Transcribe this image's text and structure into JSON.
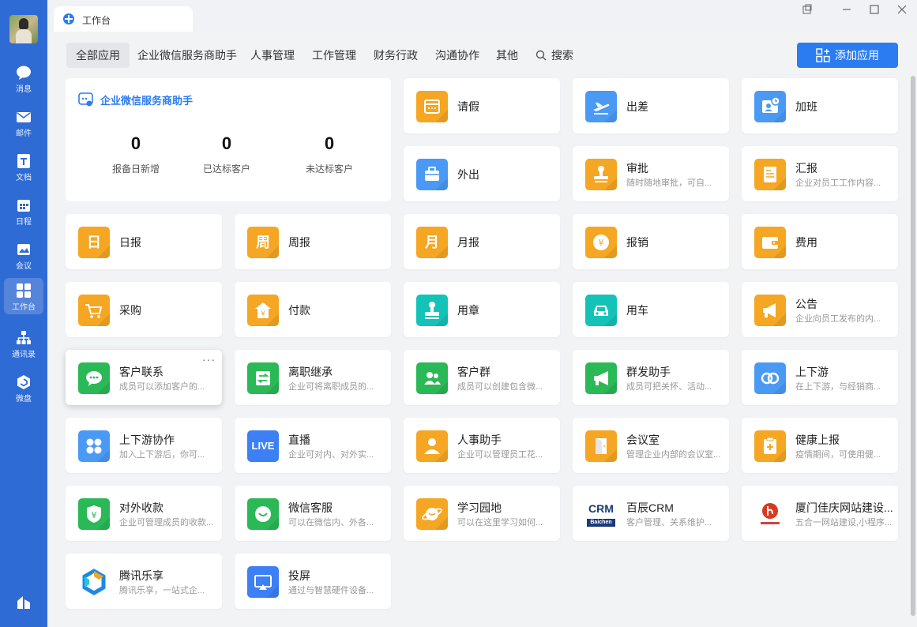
{
  "sidebar": {
    "items": [
      {
        "label": "消息",
        "icon": "chat-icon"
      },
      {
        "label": "邮件",
        "icon": "mail-icon"
      },
      {
        "label": "文档",
        "icon": "doc-icon"
      },
      {
        "label": "日程",
        "icon": "calendar-icon"
      },
      {
        "label": "会议",
        "icon": "meeting-icon"
      },
      {
        "label": "工作台",
        "icon": "grid-icon",
        "active": true
      },
      {
        "label": "通讯录",
        "icon": "contacts-icon"
      },
      {
        "label": "微盘",
        "icon": "drive-icon"
      }
    ]
  },
  "tab": {
    "title": "工作台"
  },
  "categories": [
    "全部应用",
    "企业微信服务商助手",
    "人事管理",
    "工作管理",
    "财务行政",
    "沟通协作",
    "其他",
    "搜索"
  ],
  "add_button": "添加应用",
  "helper": {
    "title": "企业微信服务商助手",
    "stats": [
      {
        "value": "0",
        "label": "报备日新增"
      },
      {
        "value": "0",
        "label": "已达标客户"
      },
      {
        "value": "0",
        "label": "未达标客户"
      }
    ]
  },
  "apps": [
    {
      "name": "请假",
      "desc": "",
      "color": "#f5a623",
      "icon": "calendar-leave-icon"
    },
    {
      "name": "出差",
      "desc": "",
      "color": "#4a9af5",
      "icon": "airplane-icon"
    },
    {
      "name": "加班",
      "desc": "",
      "color": "#4a9af5",
      "icon": "overtime-icon"
    },
    {
      "name": "外出",
      "desc": "",
      "color": "#4a9af5",
      "icon": "briefcase-icon"
    },
    {
      "name": "审批",
      "desc": "随时随地审批，可自...",
      "color": "#f5a623",
      "icon": "stamp-icon"
    },
    {
      "name": "汇报",
      "desc": "企业对员工工作内容...",
      "color": "#f5a623",
      "icon": "report-doc-icon"
    },
    {
      "name": "日报",
      "desc": "",
      "color": "#f5a623",
      "icon": "daily-icon",
      "glyph": "日"
    },
    {
      "name": "周报",
      "desc": "",
      "color": "#f5a623",
      "icon": "weekly-icon",
      "glyph": "周"
    },
    {
      "name": "月报",
      "desc": "",
      "color": "#f5a623",
      "icon": "monthly-icon",
      "glyph": "月"
    },
    {
      "name": "报销",
      "desc": "",
      "color": "#f5a623",
      "icon": "reimburse-icon"
    },
    {
      "name": "费用",
      "desc": "",
      "color": "#f5a623",
      "icon": "wallet-icon"
    },
    {
      "name": "采购",
      "desc": "",
      "color": "#f5a623",
      "icon": "cart-icon"
    },
    {
      "name": "付款",
      "desc": "",
      "color": "#f5a623",
      "icon": "payment-house-icon"
    },
    {
      "name": "用章",
      "desc": "",
      "color": "#14c3b8",
      "icon": "seal-icon"
    },
    {
      "name": "用车",
      "desc": "",
      "color": "#14c3b8",
      "icon": "car-icon"
    },
    {
      "name": "公告",
      "desc": "企业向员工发布的内...",
      "color": "#f5a623",
      "icon": "megaphone-icon"
    },
    {
      "name": "客户联系",
      "desc": "成员可以添加客户的...",
      "color": "#2bb856",
      "icon": "customer-chat-icon",
      "more": "···"
    },
    {
      "name": "离职继承",
      "desc": "企业可将离职成员的...",
      "color": "#2bb856",
      "icon": "transfer-icon"
    },
    {
      "name": "客户群",
      "desc": "成员可以创建包含微...",
      "color": "#2bb856",
      "icon": "group-icon"
    },
    {
      "name": "群发助手",
      "desc": "成员可把关怀、活动...",
      "color": "#2bb856",
      "icon": "broadcast-icon"
    },
    {
      "name": "上下游",
      "desc": "在上下游，与经销商...",
      "color": "#4a9af5",
      "icon": "link-icon"
    },
    {
      "name": "上下游协作",
      "desc": "加入上下游后，你可...",
      "color": "#4a9af5",
      "icon": "clover-icon"
    },
    {
      "name": "直播",
      "desc": "企业可对内、对外实...",
      "color": "#3d7ff5",
      "icon": "live-icon",
      "glyph": "LIVE"
    },
    {
      "name": "人事助手",
      "desc": "企业可以管理员工花...",
      "color": "#f5a623",
      "icon": "person-icon"
    },
    {
      "name": "会议室",
      "desc": "管理企业内部的会议室...",
      "color": "#f5a623",
      "icon": "door-icon"
    },
    {
      "name": "健康上报",
      "desc": "疫情期间，可使用健...",
      "color": "#f5a623",
      "icon": "health-icon"
    },
    {
      "name": "对外收款",
      "desc": "企业可管理成员的收款...",
      "color": "#2bb856",
      "icon": "yuan-shield-icon"
    },
    {
      "name": "微信客服",
      "desc": "可以在微信内、外各...",
      "color": "#2bb856",
      "icon": "wechat-service-icon"
    },
    {
      "name": "学习园地",
      "desc": "可以在这里学习如何...",
      "color": "#f5a623",
      "icon": "planet-icon"
    },
    {
      "name": "百辰CRM",
      "desc": "客户管理、关系维护...",
      "color": "#ffffff",
      "icon": "baichen-crm-logo",
      "glyph": "CRM",
      "glyph2": "Baichen"
    },
    {
      "name": "厦门佳庆网站建设...",
      "desc": "五合一网站建设,小程序...",
      "color": "#ffffff",
      "icon": "jiaqing-logo"
    },
    {
      "name": "腾讯乐享",
      "desc": "腾讯乐享，一站式企...",
      "color": "#ffffff",
      "icon": "tencent-lexiang-logo"
    },
    {
      "name": "投屏",
      "desc": "通过与智慧硬件设备...",
      "color": "#3d7ff5",
      "icon": "screen-cast-icon"
    }
  ]
}
